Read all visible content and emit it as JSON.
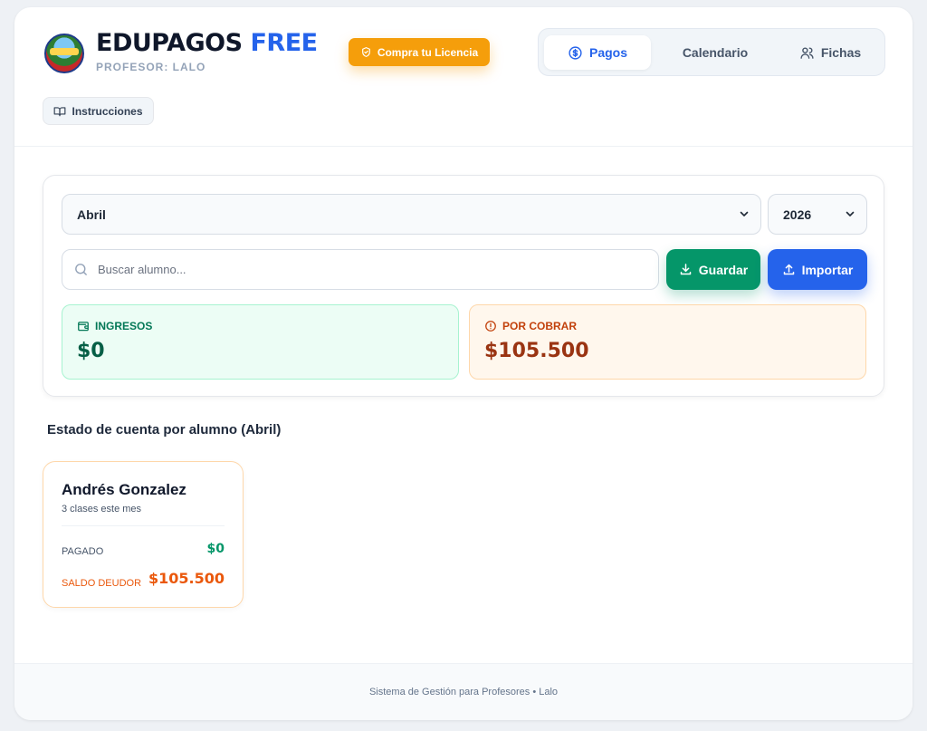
{
  "brand": {
    "title_main": "EDUPAGOS",
    "title_accent": "FREE",
    "subtitle": "PROFESOR: LALO"
  },
  "header": {
    "license_label": "Compra tu Licencia",
    "instructions_label": "Instrucciones"
  },
  "nav": {
    "tabs": [
      {
        "label": "Pagos"
      },
      {
        "label": "Calendario"
      },
      {
        "label": "Fichas"
      }
    ]
  },
  "filters": {
    "month": "Abril",
    "year": "2026"
  },
  "search": {
    "placeholder": "Buscar alumno..."
  },
  "actions": {
    "save_label": "Guardar",
    "import_label": "Importar"
  },
  "stats": {
    "income": {
      "label": "INGRESOS",
      "value": "$0"
    },
    "pending": {
      "label": "POR COBRAR",
      "value": "$105.500"
    }
  },
  "section": {
    "title": "Estado de cuenta por alumno (Abril)"
  },
  "students": [
    {
      "name": "Andrés Gonzalez",
      "classes": "3 clases este mes",
      "paid_label": "PAGADO",
      "paid_value": "$0",
      "debt_label": "SALDO DEUDOR",
      "debt_value": "$105.500"
    }
  ],
  "footer": {
    "text": "Sistema de Gestión para Profesores • Lalo"
  },
  "colors": {
    "primary": "#2563eb",
    "success": "#059669",
    "warning": "#f59e0b",
    "debt": "#ea580c"
  }
}
